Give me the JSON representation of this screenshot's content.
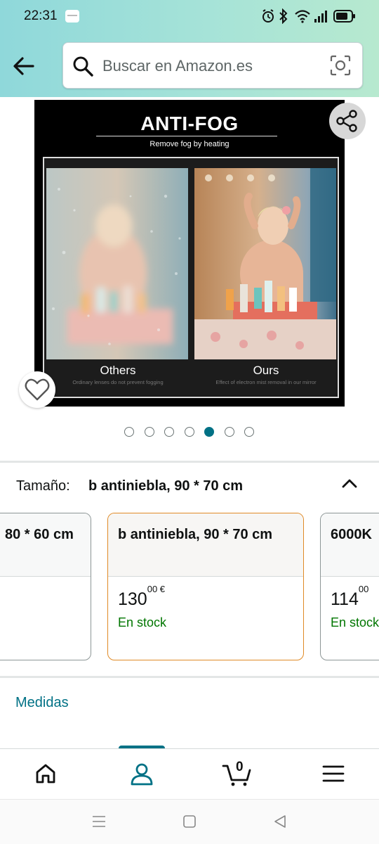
{
  "status_bar": {
    "time": "22:31",
    "icons": [
      "notification-icon",
      "alarm-icon",
      "bluetooth-icon",
      "wifi-icon",
      "signal-icon",
      "battery-icon"
    ]
  },
  "header": {
    "back_icon": "arrow-left-icon",
    "search_placeholder": "Buscar en Amazon.es",
    "camera_icon": "camera-scan-icon"
  },
  "product_image": {
    "title": "ANTI-FOG",
    "subtitle": "Remove fog by heating",
    "left_caption": "Others",
    "left_note": "Ordinary lenses do not prevent fogging",
    "right_caption": "Ours",
    "right_note": "Effect of electron mist removal in our mirror"
  },
  "gallery": {
    "count": 7,
    "active_index": 4
  },
  "size": {
    "label": "Tamaño:",
    "selected": "b antiniebla, 90 * 70 cm",
    "options": [
      {
        "name": "80 * 60 cm",
        "price_whole": "",
        "price_fraction": "",
        "stock": ""
      },
      {
        "name": "b antiniebla, 90 * 70 cm",
        "price_whole": "130",
        "price_fraction": "00 €",
        "stock": "En stock"
      },
      {
        "name": "6000K",
        "price_whole": "114",
        "price_fraction": "00",
        "stock": "En stock"
      }
    ]
  },
  "details": {
    "medidas_link": "Medidas"
  },
  "bottom_nav": {
    "cart_count": "0",
    "items": [
      "home-icon",
      "account-icon",
      "cart-icon",
      "menu-icon"
    ],
    "active": "account-icon"
  },
  "colors": {
    "accent": "#007185",
    "stock": "#007600",
    "selected_border": "#e08a26"
  }
}
